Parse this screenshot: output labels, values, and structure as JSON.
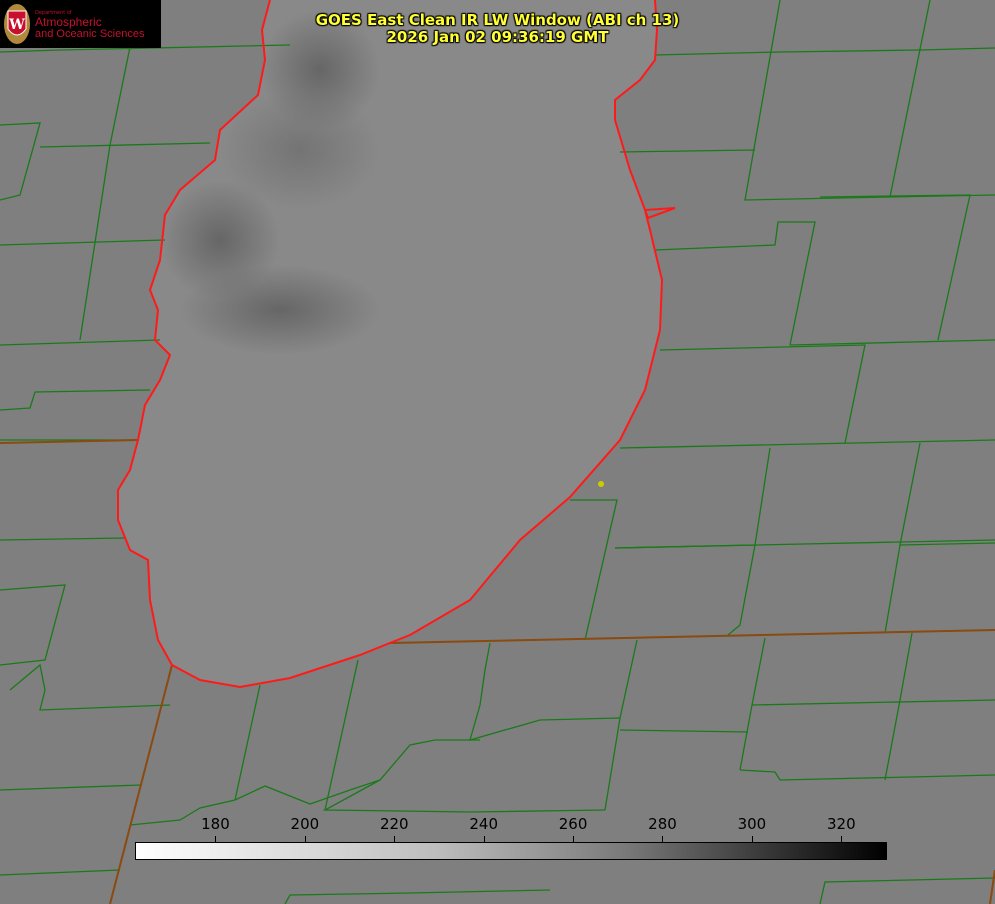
{
  "logo": {
    "dept": "Department of",
    "line1": "Atmospheric",
    "line2": "and Oceanic Sciences",
    "letter": "W"
  },
  "title": {
    "line1": "GOES East Clean IR LW Window (ABI ch 13)",
    "line2": "2026 Jan 02 09:36:19 GMT"
  },
  "colorbar": {
    "ticks": [
      "180",
      "200",
      "220",
      "240",
      "260",
      "280",
      "300",
      "320"
    ],
    "tick_values": [
      180,
      200,
      220,
      240,
      260,
      280,
      300,
      320
    ],
    "range": [
      162,
      330
    ],
    "colormap": "white-to-black (cold white, warm black)"
  },
  "colors": {
    "county_lines": "#1a7a1a",
    "coastline": "#ff1a1a",
    "title": "#ffff33",
    "marker": "#cccc00"
  }
}
